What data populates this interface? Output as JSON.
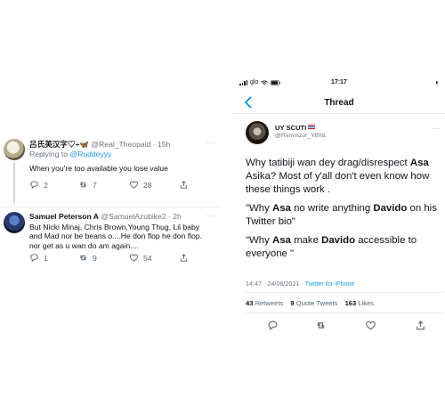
{
  "left": {
    "tweet1": {
      "name": "吕氏英汉字♡÷🦋",
      "handle": "@Real_Theopaid",
      "time": "· 15h",
      "more": "···",
      "replying_label": "Replying to",
      "replying_to": "@Ruddeyyy",
      "text": "When you're too available you lose value",
      "stats": {
        "replies": "2",
        "retweets": "7",
        "likes": "28"
      }
    },
    "tweet2": {
      "name": "Samuel Peterson A",
      "handle": "@SamuelAzubike2",
      "time": "· 2h",
      "more": "···",
      "text": "But Nicki Minaj, Chris Brown,Young Thug, Lil baby\nand Mad nor be beans o....He don flop he don flop.\nnor get as u wan do am again....",
      "stats": {
        "replies": "1",
        "retweets": "9",
        "likes": "54"
      }
    }
  },
  "phone": {
    "status": {
      "carrier": "glo",
      "time": "17:17",
      "right_icon": "◐"
    },
    "nav_title": "Thread",
    "author": {
      "name": "UY SCUTI",
      "handle": "@Remmzor_YBNL"
    },
    "more": "···",
    "text": {
      "p1_a": "Why tatibiji wan dey drag/disrespect ",
      "p1_asa": "Asa",
      "p1_b": " Asika? Most of y'all don't even know how these things work .",
      "p2_a": "\"Why ",
      "p2_asa": "Asa",
      "p2_b": " no write anything ",
      "p2_davido": "Davido",
      "p2_c": " on his Twitter bio\"",
      "p3_a": "\"Why ",
      "p3_asa": "Asa",
      "p3_b": " make ",
      "p3_davido": "Davido",
      "p3_c": " accessible to everyone \""
    },
    "meta": {
      "timestamp": "14:47 · 24/06/2021 · ",
      "source": "Twitter for iPhone"
    },
    "stats": {
      "retweets_count": "43",
      "retweets_label": "Retweets",
      "quotes_count": "9",
      "quotes_label": "Quote Tweets",
      "likes_count": "163",
      "likes_label": "Likes"
    }
  }
}
